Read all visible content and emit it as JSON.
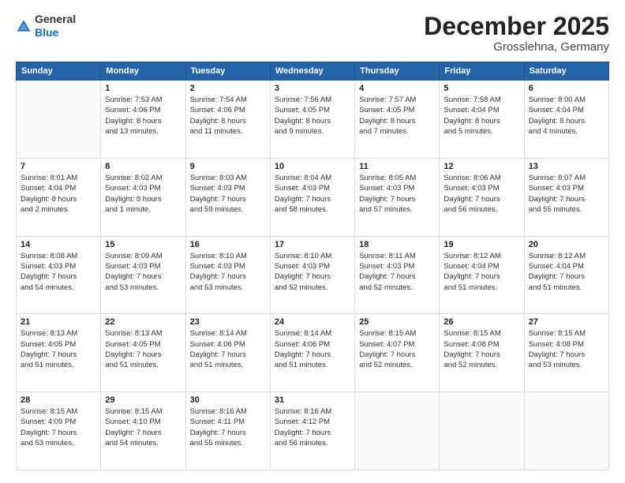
{
  "header": {
    "logo_line1": "General",
    "logo_line2": "Blue",
    "month_title": "December 2025",
    "location": "Grosslehna, Germany"
  },
  "days_of_week": [
    "Sunday",
    "Monday",
    "Tuesday",
    "Wednesday",
    "Thursday",
    "Friday",
    "Saturday"
  ],
  "weeks": [
    [
      {
        "day": "",
        "info": ""
      },
      {
        "day": "1",
        "info": "Sunrise: 7:53 AM\nSunset: 4:06 PM\nDaylight: 8 hours\nand 13 minutes."
      },
      {
        "day": "2",
        "info": "Sunrise: 7:54 AM\nSunset: 4:06 PM\nDaylight: 8 hours\nand 11 minutes."
      },
      {
        "day": "3",
        "info": "Sunrise: 7:56 AM\nSunset: 4:05 PM\nDaylight: 8 hours\nand 9 minutes."
      },
      {
        "day": "4",
        "info": "Sunrise: 7:57 AM\nSunset: 4:05 PM\nDaylight: 8 hours\nand 7 minutes."
      },
      {
        "day": "5",
        "info": "Sunrise: 7:58 AM\nSunset: 4:04 PM\nDaylight: 8 hours\nand 5 minutes."
      },
      {
        "day": "6",
        "info": "Sunrise: 8:00 AM\nSunset: 4:04 PM\nDaylight: 8 hours\nand 4 minutes."
      }
    ],
    [
      {
        "day": "7",
        "info": "Sunrise: 8:01 AM\nSunset: 4:04 PM\nDaylight: 8 hours\nand 2 minutes."
      },
      {
        "day": "8",
        "info": "Sunrise: 8:02 AM\nSunset: 4:03 PM\nDaylight: 8 hours\nand 1 minute."
      },
      {
        "day": "9",
        "info": "Sunrise: 8:03 AM\nSunset: 4:03 PM\nDaylight: 7 hours\nand 59 minutes."
      },
      {
        "day": "10",
        "info": "Sunrise: 8:04 AM\nSunset: 4:03 PM\nDaylight: 7 hours\nand 58 minutes."
      },
      {
        "day": "11",
        "info": "Sunrise: 8:05 AM\nSunset: 4:03 PM\nDaylight: 7 hours\nand 57 minutes."
      },
      {
        "day": "12",
        "info": "Sunrise: 8:06 AM\nSunset: 4:03 PM\nDaylight: 7 hours\nand 56 minutes."
      },
      {
        "day": "13",
        "info": "Sunrise: 8:07 AM\nSunset: 4:03 PM\nDaylight: 7 hours\nand 55 minutes."
      }
    ],
    [
      {
        "day": "14",
        "info": "Sunrise: 8:08 AM\nSunset: 4:03 PM\nDaylight: 7 hours\nand 54 minutes."
      },
      {
        "day": "15",
        "info": "Sunrise: 8:09 AM\nSunset: 4:03 PM\nDaylight: 7 hours\nand 53 minutes."
      },
      {
        "day": "16",
        "info": "Sunrise: 8:10 AM\nSunset: 4:03 PM\nDaylight: 7 hours\nand 53 minutes."
      },
      {
        "day": "17",
        "info": "Sunrise: 8:10 AM\nSunset: 4:03 PM\nDaylight: 7 hours\nand 52 minutes."
      },
      {
        "day": "18",
        "info": "Sunrise: 8:11 AM\nSunset: 4:03 PM\nDaylight: 7 hours\nand 52 minutes."
      },
      {
        "day": "19",
        "info": "Sunrise: 8:12 AM\nSunset: 4:04 PM\nDaylight: 7 hours\nand 51 minutes."
      },
      {
        "day": "20",
        "info": "Sunrise: 8:12 AM\nSunset: 4:04 PM\nDaylight: 7 hours\nand 51 minutes."
      }
    ],
    [
      {
        "day": "21",
        "info": "Sunrise: 8:13 AM\nSunset: 4:05 PM\nDaylight: 7 hours\nand 51 minutes."
      },
      {
        "day": "22",
        "info": "Sunrise: 8:13 AM\nSunset: 4:05 PM\nDaylight: 7 hours\nand 51 minutes."
      },
      {
        "day": "23",
        "info": "Sunrise: 8:14 AM\nSunset: 4:06 PM\nDaylight: 7 hours\nand 51 minutes."
      },
      {
        "day": "24",
        "info": "Sunrise: 8:14 AM\nSunset: 4:06 PM\nDaylight: 7 hours\nand 51 minutes."
      },
      {
        "day": "25",
        "info": "Sunrise: 8:15 AM\nSunset: 4:07 PM\nDaylight: 7 hours\nand 52 minutes."
      },
      {
        "day": "26",
        "info": "Sunrise: 8:15 AM\nSunset: 4:08 PM\nDaylight: 7 hours\nand 52 minutes."
      },
      {
        "day": "27",
        "info": "Sunrise: 8:15 AM\nSunset: 4:08 PM\nDaylight: 7 hours\nand 53 minutes."
      }
    ],
    [
      {
        "day": "28",
        "info": "Sunrise: 8:15 AM\nSunset: 4:09 PM\nDaylight: 7 hours\nand 53 minutes."
      },
      {
        "day": "29",
        "info": "Sunrise: 8:15 AM\nSunset: 4:10 PM\nDaylight: 7 hours\nand 54 minutes."
      },
      {
        "day": "30",
        "info": "Sunrise: 8:16 AM\nSunset: 4:11 PM\nDaylight: 7 hours\nand 55 minutes."
      },
      {
        "day": "31",
        "info": "Sunrise: 8:16 AM\nSunset: 4:12 PM\nDaylight: 7 hours\nand 56 minutes."
      },
      {
        "day": "",
        "info": ""
      },
      {
        "day": "",
        "info": ""
      },
      {
        "day": "",
        "info": ""
      }
    ]
  ]
}
